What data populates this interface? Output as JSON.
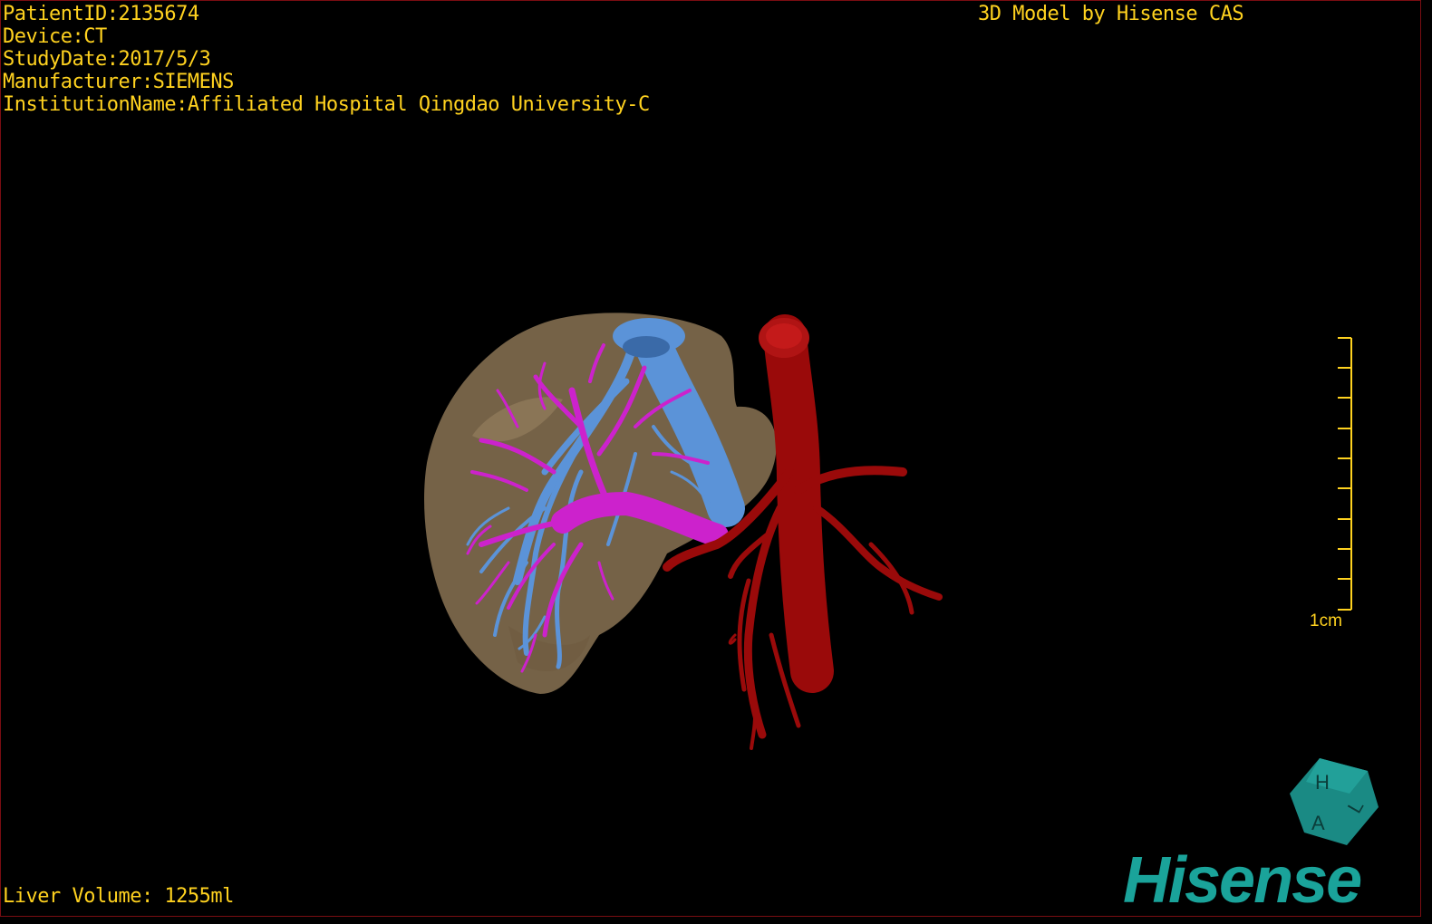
{
  "header": {
    "patient_id": "PatientID:2135674",
    "device": "Device:CT",
    "study_date": "StudyDate:2017/5/3",
    "manufacturer": "Manufacturer:SIEMENS",
    "institution": "InstitutionName:Affiliated Hospital Qingdao University-C"
  },
  "credit": "3D Model by Hisense CAS",
  "liver_volume": "Liver Volume: 1255ml",
  "scale_bar": {
    "label": "1cm"
  },
  "orientation_cube": {
    "letters": [
      "H",
      "A",
      "L"
    ],
    "icon": "orientation-cube-icon"
  },
  "brand": "Hisense",
  "colors": {
    "text": "#ffd21f",
    "liver": "#8a7354",
    "portal_vein": "#cc22cc",
    "hepatic_vein": "#5b93d8",
    "artery": "#9a0a0a",
    "brand": "#1aa39a"
  }
}
